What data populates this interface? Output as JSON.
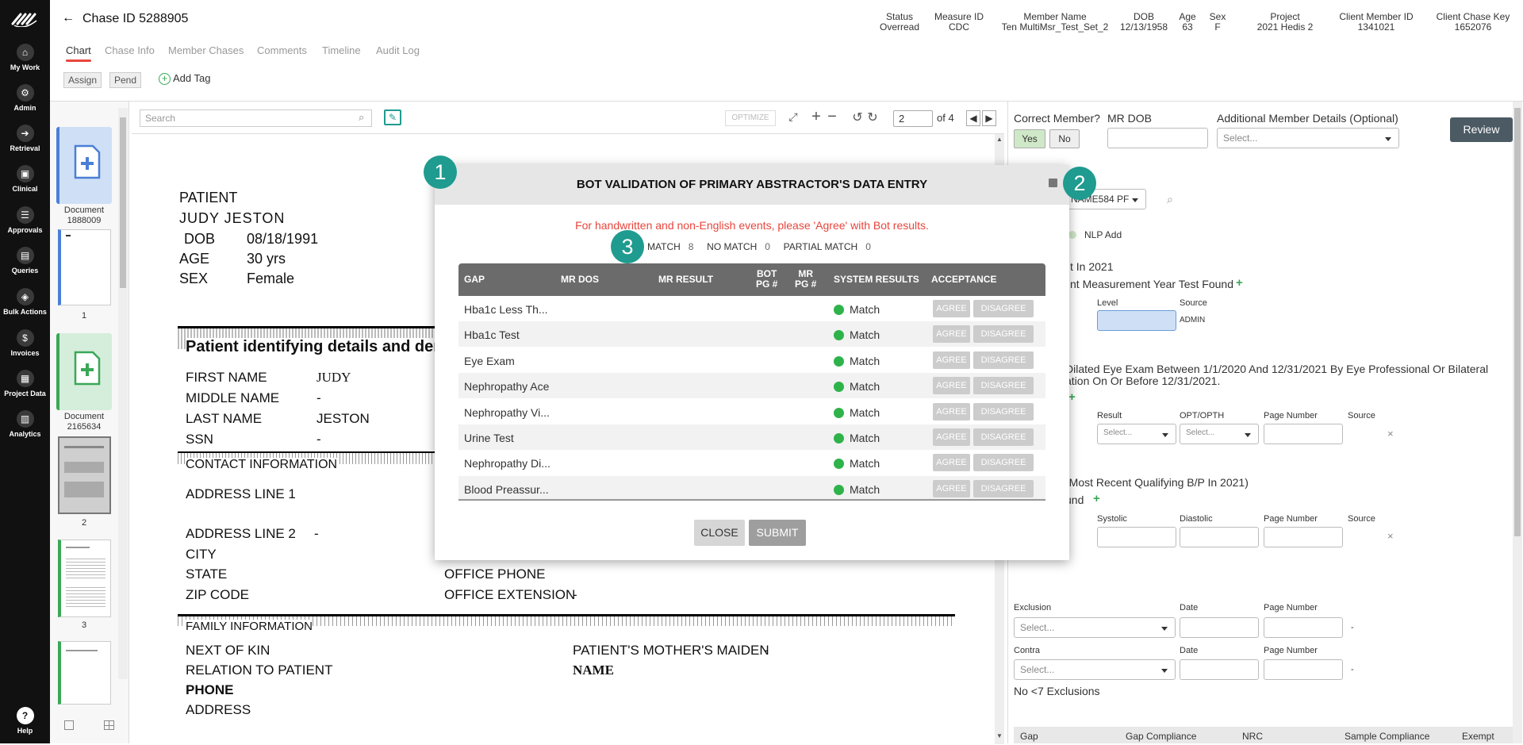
{
  "sidebar": {
    "items": [
      {
        "label": "My Work",
        "icon": "home-icon"
      },
      {
        "label": "Admin",
        "icon": "gear-icon"
      },
      {
        "label": "Retrieval",
        "icon": "retrieval-icon"
      },
      {
        "label": "Clinical",
        "icon": "clinical-icon"
      },
      {
        "label": "Approvals",
        "icon": "approvals-icon"
      },
      {
        "label": "Queries",
        "icon": "queries-icon"
      },
      {
        "label": "Bulk Actions",
        "icon": "layers-icon"
      },
      {
        "label": "Invoices",
        "icon": "dollar-icon"
      },
      {
        "label": "Project Data",
        "icon": "project-data-icon"
      },
      {
        "label": "Analytics",
        "icon": "bar-chart-icon"
      }
    ],
    "help_label": "Help"
  },
  "header": {
    "title": "Chase ID 5288905",
    "tabs": [
      "Chart",
      "Chase Info",
      "Member Chases",
      "Comments",
      "Timeline",
      "Audit Log"
    ],
    "assign_label": "Assign",
    "pend_label": "Pend",
    "add_tag_label": "Add Tag",
    "fields": [
      {
        "label": "Status",
        "value": "Overread"
      },
      {
        "label": "Measure ID",
        "value": "CDC"
      },
      {
        "label": "Member Name",
        "value": "Ten MultiMsr_Test_Set_2"
      },
      {
        "label": "DOB",
        "value": "12/13/1958"
      },
      {
        "label": "Age",
        "value": "63"
      },
      {
        "label": "Sex",
        "value": "F"
      },
      {
        "label": "Project",
        "value": "2021 Hedis 2"
      },
      {
        "label": "Client Member ID",
        "value": "1341021"
      },
      {
        "label": "Client Chase Key",
        "value": "1652076"
      }
    ]
  },
  "thumbnails": {
    "doc1": {
      "label": "Document",
      "id": "1888009"
    },
    "page1": "1",
    "doc2": {
      "label": "Document",
      "id": "2165634"
    },
    "page2": "2",
    "page3": "3"
  },
  "viewer": {
    "search_placeholder": "Search",
    "optimize_label": "OPTIMIZE",
    "page_value": "2",
    "page_total": "of 4"
  },
  "document": {
    "patient_label": "PATIENT",
    "patient_name": "JUDY JESTON",
    "dob_label": "DOB",
    "dob_value": "08/18/1991",
    "age_label": "AGE",
    "age_value": "30 yrs",
    "sex_label": "SEX",
    "sex_value": "Female",
    "section_identifying": "Patient identifying details and demo",
    "first_name_label": "FIRST NAME",
    "first_name_value": "JUDY",
    "middle_name_label": "MIDDLE NAME",
    "middle_name_value": "-",
    "last_name_label": "LAST NAME",
    "last_name_value": "JESTON",
    "ssn_label": "SSN",
    "ssn_value": "-",
    "section_contact": "CONTACT INFORMATION",
    "address1_label": "ADDRESS LINE 1",
    "address2_label": "ADDRESS LINE 2",
    "address2_value": "-",
    "city_label": "CITY",
    "state_label": "STATE",
    "zip_label": "ZIP CODE",
    "office_phone_label": "OFFICE PHONE",
    "office_ext_label": "OFFICE EXTENSION",
    "office_ext_value": "-",
    "section_family": "FAMILY INFORMATION",
    "next_of_kin_label": "NEXT OF KIN",
    "relation_label": "RELATION TO PATIENT",
    "phone_label": "PHONE",
    "address_label": "ADDRESS",
    "mother_maiden_label": "PATIENT'S MOTHER'S MAIDEN",
    "mother_maiden_label2": "NAME",
    "mother_maiden_value": "-"
  },
  "right_panel": {
    "correct_member_label": "Correct Member?",
    "yes_label": "Yes",
    "no_label": "No",
    "mr_dob_label": "MR DOB",
    "additional_label": "Additional Member Details (Optional)",
    "select_placeholder": "Select...",
    "review_label": "Review",
    "provider_select": "NAME584 PF",
    "nlp_add_label": "NLP Add",
    "hba1c_title": "t In 2021",
    "hba1c_sub": "nt Measurement Year Test Found",
    "level_label": "Level",
    "source_label": "Source",
    "source_value": "ADMIN",
    "eye_title_1": "Dilated Eye Exam Between 1/1/2020 And 12/31/2021 By Eye Professional Or Bilateral",
    "eye_title_2": "ation On Or Before 12/31/2021.",
    "result_label": "Result",
    "optopth_label": "OPT/OPTH",
    "page_number_label": "Page Number",
    "bp_title": "(Most Recent Qualifying B/P In 2021)",
    "bp_sub": "und",
    "systolic_label": "Systolic",
    "diastolic_label": "Diastolic",
    "exclusion_label": "Exclusion",
    "date_label": "Date",
    "contra_label": "Contra",
    "dash": "-",
    "no_exclusions": "No <7 Exclusions",
    "footer_gap": "Gap",
    "footer_compliance": "Gap Compliance",
    "footer_nrc": "NRC",
    "footer_sample": "Sample Compliance",
    "footer_exempt": "Exempt"
  },
  "modal": {
    "title": "BOT VALIDATION OF PRIMARY ABSTRACTOR'S DATA ENTRY",
    "notice": "For handwritten and non-English events, please 'Agree' with Bot results.",
    "match_label": "MATCH",
    "match_count": "8",
    "no_match_label": "NO MATCH",
    "no_match_count": "0",
    "partial_label": "PARTIAL MATCH",
    "partial_count": "0",
    "columns": [
      "GAP",
      "MR DOS",
      "MR RESULT",
      "BOT PG #",
      "MR PG #",
      "SYSTEM RESULTS",
      "ACCEPTANCE"
    ],
    "bot_pg_l1": "BOT",
    "bot_pg_l2": "PG #",
    "mr_pg_l1": "MR",
    "mr_pg_l2": "PG #",
    "rows": [
      {
        "gap": "Hba1c Less Th...",
        "result": "Match"
      },
      {
        "gap": "Hba1c Test",
        "result": "Match"
      },
      {
        "gap": "Eye Exam",
        "result": "Match"
      },
      {
        "gap": "Nephropathy Ace",
        "result": "Match"
      },
      {
        "gap": "Nephropathy Vi...",
        "result": "Match"
      },
      {
        "gap": "Urine Test",
        "result": "Match"
      },
      {
        "gap": "Nephropathy Di...",
        "result": "Match"
      },
      {
        "gap": "Blood Preassur...",
        "result": "Match"
      }
    ],
    "agree_label": "AGREE",
    "disagree_label": "DISAGREE",
    "close_label": "CLOSE",
    "submit_label": "SUBMIT"
  },
  "callouts": [
    "1",
    "2",
    "3"
  ],
  "colors": {
    "accent": "#1f9b8f",
    "sidebar": "#111111",
    "notice": "#e8453c",
    "match": "#2eb34a"
  }
}
